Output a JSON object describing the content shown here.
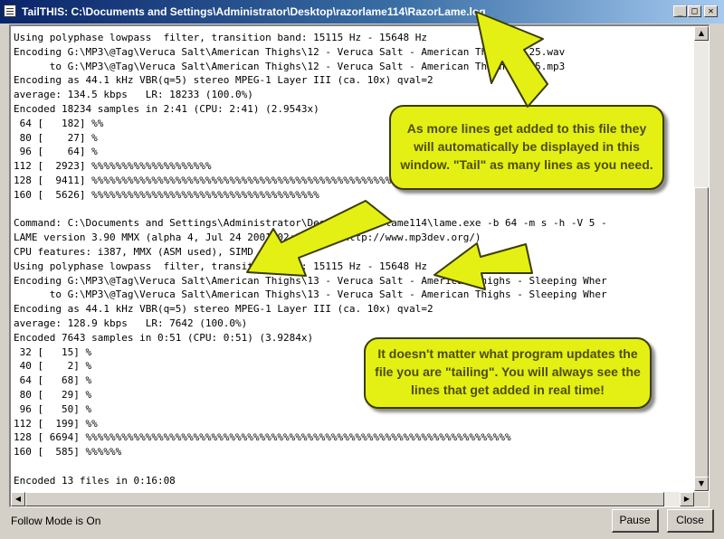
{
  "window": {
    "title": "TailTHIS: C:\\Documents and Settings\\Administrator\\Desktop\\razorlame114\\RazorLame.log",
    "icon": "log-file-icon",
    "controls": {
      "minimize": "_",
      "maximize": "□",
      "close": "✕"
    }
  },
  "log": {
    "lines": [
      "Using polyphase lowpass  filter, transition band: 15115 Hz - 15648 Hz",
      "Encoding G:\\MP3\\@Tag\\Veruca Salt\\American Thighs\\12 - Veruca Salt - American Thighs - 25.wav",
      "      to G:\\MP3\\@Tag\\Veruca Salt\\American Thighs\\12 - Veruca Salt - American Thighs - 25.mp3",
      "Encoding as 44.1 kHz VBR(q=5) stereo MPEG-1 Layer III (ca. 10x) qval=2",
      "average: 134.5 kbps   LR: 18233 (100.0%)",
      "Encoded 18234 samples in 2:41 (CPU: 2:41) (2.9543x)",
      " 64 [   182] %%",
      " 80 [    27] %",
      " 96 [    64] %",
      "112 [  2923] %%%%%%%%%%%%%%%%%%%%",
      "128 [  9411] %%%%%%%%%%%%%%%%%%%%%%%%%%%%%%%%%%%%%%%%%%%%%%%%%%%%%%%%%%%%%%%",
      "160 [  5626] %%%%%%%%%%%%%%%%%%%%%%%%%%%%%%%%%%%%%%",
      "",
      "Command: C:\\Documents and Settings\\Administrator\\Desktop\\razorlame114\\lame.exe -b 64 -m s -h -V 5 -",
      "LAME version 3.90 MMX (alpha 4, Jul 24 2001 02:13:47) (http://www.mp3dev.org/)",
      "CPU features: i387, MMX (ASM used), SIMD",
      "Using polyphase lowpass  filter, transition band: 15115 Hz - 15648 Hz",
      "Encoding G:\\MP3\\@Tag\\Veruca Salt\\American Thighs\\13 - Veruca Salt - American Thighs - Sleeping Wher",
      "      to G:\\MP3\\@Tag\\Veruca Salt\\American Thighs\\13 - Veruca Salt - American Thighs - Sleeping Wher",
      "Encoding as 44.1 kHz VBR(q=5) stereo MPEG-1 Layer III (ca. 10x) qval=2",
      "average: 128.9 kbps   LR: 7642 (100.0%)",
      "Encoded 7643 samples in 0:51 (CPU: 0:51) (3.9284x)",
      " 32 [   15] %",
      " 40 [    2] %",
      " 64 [   68] %",
      " 80 [   29] %",
      " 96 [   50] %",
      "112 [  199] %%",
      "128 [ 6694] %%%%%%%%%%%%%%%%%%%%%%%%%%%%%%%%%%%%%%%%%%%%%%%%%%%%%%%%%%%%%%%%%%%%%%%",
      "160 [  585] %%%%%%",
      "",
      "Encoded 13 files in 0:16:08"
    ]
  },
  "callouts": [
    {
      "text": "As more lines get added to this file they will automatically be displayed in this window. \"Tail\" as many lines as you need."
    },
    {
      "text": "It doesn't matter what program updates the file you are \"tailing\". You will always see the lines that get added in real time!"
    }
  ],
  "status": {
    "text": "Follow Mode is On"
  },
  "buttons": {
    "pause": "Pause",
    "close": "Close"
  },
  "colors": {
    "callout_fill": "#e4f014",
    "callout_text": "#4d4d00",
    "titlebar_start": "#0a246a",
    "titlebar_end": "#a6caf0"
  }
}
